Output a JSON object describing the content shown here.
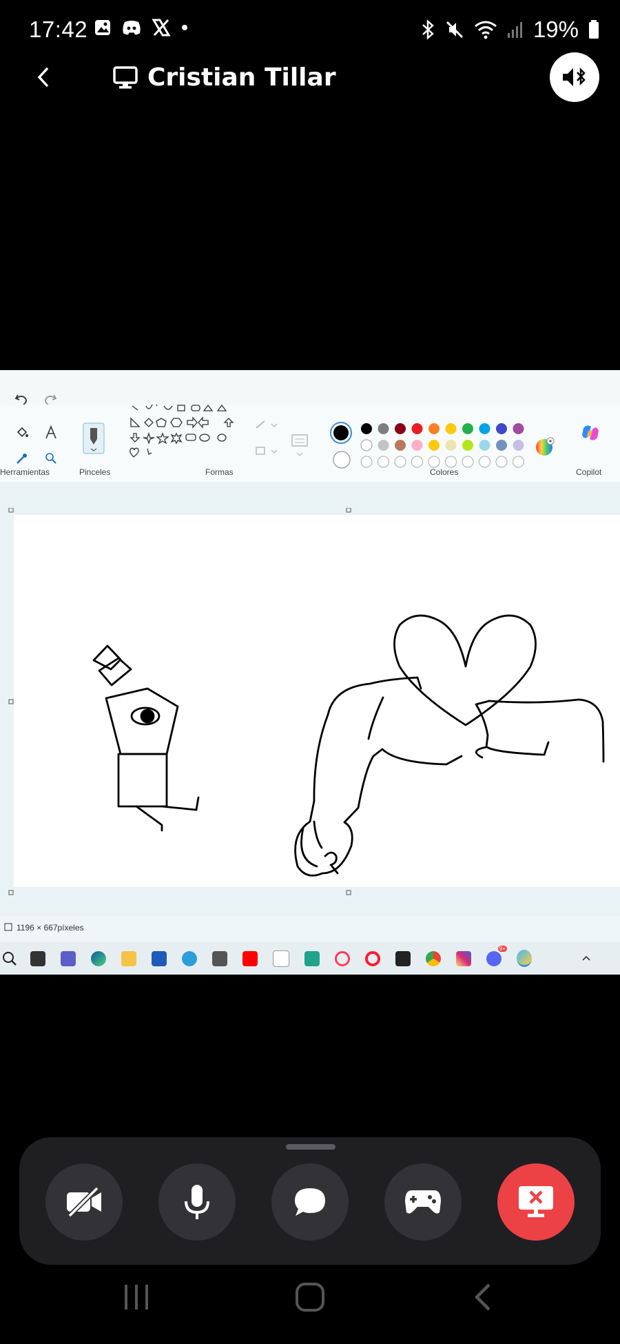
{
  "status_bar": {
    "time": "17:42",
    "battery": "19%",
    "left_icons": [
      "image-icon",
      "discord-icon",
      "x-icon",
      "dot-icon"
    ],
    "right_icons": [
      "bluetooth-icon",
      "mute-icon",
      "wifi-icon",
      "signal-icon",
      "battery-icon"
    ]
  },
  "header": {
    "title": "Cristian Tillar",
    "back_icon": "chevron-left-icon",
    "screen_icon": "monitor-icon",
    "audio_icon": "speaker-bluetooth-icon"
  },
  "paint": {
    "sections": {
      "tools": "Herramientas",
      "brushes": "Pinceles",
      "shapes": "Formas",
      "colors": "Colores",
      "copilot": "Copilot"
    },
    "canvas_size": "1196 × 667píxeles",
    "palette_row1": [
      "#000000",
      "#7f7f7f",
      "#880015",
      "#ed1c24",
      "#ff7f27",
      "#ffc90e",
      "#22b14c",
      "#00a2e8",
      "#3f48cc",
      "#a349a4"
    ],
    "palette_row2": [
      "#ffffff",
      "#c3c3c3",
      "#b97a57",
      "#ffaec9",
      "#ffc90e",
      "#efe4b0",
      "#b5e61d",
      "#99d9ea",
      "#7092be",
      "#c8bfe7"
    ]
  },
  "taskbar": {
    "icons": [
      "search-icon",
      "task-view-icon",
      "teams-icon",
      "edge-icon",
      "explorer-icon",
      "store-icon",
      "app-icon",
      "app-icon",
      "youtube-icon",
      "amazon-icon",
      "app-icon",
      "opera-gx-icon",
      "opera-icon",
      "play-icon",
      "chrome-icon",
      "instagram-icon",
      "discord-icon",
      "paint-icon"
    ],
    "discord_badge": "9+"
  },
  "controls": {
    "buttons": [
      "camera-off-icon",
      "microphone-icon",
      "chat-icon",
      "gamepad-icon",
      "stop-share-icon"
    ]
  },
  "colors": {
    "end_call": "#ed4245",
    "control_bg": "#333337",
    "panel_bg": "#1f1f22"
  }
}
